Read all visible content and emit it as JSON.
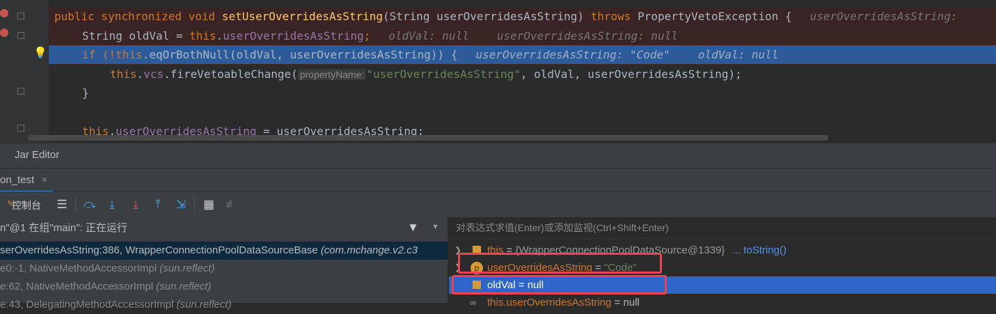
{
  "editor": {
    "lines": [
      {
        "kw1": "public synchronized void ",
        "fn": "setUserOverridesAsString",
        "rest": "(String userOverridesAsString) ",
        "kw2": "throws",
        "rest2": " PropertyVetoException {",
        "hint": "userOverridesAsString:"
      },
      {
        "pre": "String oldVal = ",
        "kw": "this",
        "dot": ".",
        "fld": "userOverridesAsString",
        "semi": ";",
        "hint1": "oldVal: null",
        "hint2": "userOverridesAsString: null"
      },
      {
        "pre": "if (!",
        "kw": "this",
        "rest": ".eqOrBothNull(oldVal, userOverridesAsString)) {",
        "hint1": "userOverridesAsString: \"Code\"",
        "hint2": "oldVal: null"
      },
      {
        "kw": "this",
        "dot": ".",
        "fld": "vcs",
        "rest": ".fireVetoableChange(",
        "param": "propertyName:",
        "str": "\"userOverridesAsString\"",
        "rest2": ", oldVal, userOverridesAsString);"
      },
      {
        "text": "}"
      },
      {
        "kw": "this",
        "dot": ".",
        "fld": "userOverridesAsString",
        "rest": " = userOverridesAsString;"
      }
    ]
  },
  "jar_editor": {
    "label": "Jar Editor"
  },
  "debug_tab": {
    "label": "on_test",
    "close": "×"
  },
  "toolbar": {
    "console_label": "控制台"
  },
  "frames": {
    "thread_label": "n\"@1 在组\"main\": 正在运行",
    "rows": [
      {
        "method": "serOverridesAsString:386, WrapperConnectionPoolDataSourceBase",
        "pkg": "(com.mchange.v2.c3"
      },
      {
        "method": "e0:-1, NativeMethodAccessorImpl",
        "pkg": "(sun.reflect)"
      },
      {
        "method": "e:62, NativeMethodAccessorImpl",
        "pkg": "(sun.reflect)"
      },
      {
        "method": "e:43, DelegatingMethodAccessorImpl",
        "pkg": "(sun.reflect)"
      }
    ]
  },
  "variables": {
    "eval_placeholder": "对表达式求值(Enter)或添加监视(Ctrl+Shift+Enter)",
    "rows": [
      {
        "name": "this",
        "eq": " = ",
        "value": "{WrapperConnectionPoolDataSource@1339}",
        "link": "... toString()"
      },
      {
        "badge": "p",
        "name": "userOverridesAsString",
        "eq": " = ",
        "value": "\"Code\""
      },
      {
        "name": "oldVal",
        "eq": " = ",
        "value": "null"
      },
      {
        "name": "this.userOverridesAsString",
        "eq": " = ",
        "value": "null"
      }
    ]
  },
  "colors": {
    "keyword": "#cc7832",
    "function": "#ffc66d",
    "field": "#9876aa",
    "string": "#6a8759",
    "selection": "#2d5b9a",
    "highlight_box": "#e8454f"
  }
}
